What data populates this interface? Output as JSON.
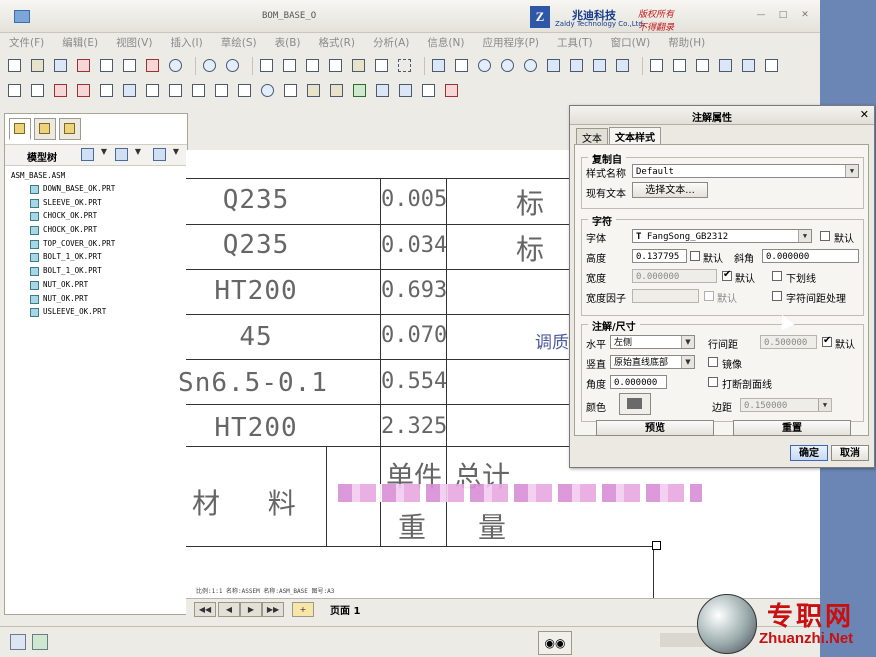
{
  "window": {
    "title": "BOM_BASE_O",
    "logo_mark": "Z",
    "logo_company_cn": "兆迪科技",
    "logo_company_en": "Zaldy Technology Co.,Ltd.",
    "logo_slogan_1": "版权所有",
    "logo_slogan_2": "不得翻录"
  },
  "menu": [
    "文件(F)",
    "编辑(E)",
    "视图(V)",
    "插入(I)",
    "草绘(S)",
    "表(B)",
    "格式(R)",
    "分析(A)",
    "信息(N)",
    "应用程序(P)",
    "工具(T)",
    "窗口(W)",
    "帮助(H)"
  ],
  "model_tree": {
    "title": "模型树",
    "root": "ASM_BASE.ASM",
    "items": [
      "DOWN_BASE_OK.PRT",
      "SLEEVE_OK.PRT",
      "CHOCK_OK.PRT",
      "CHOCK_OK.PRT",
      "TOP_COVER_OK.PRT",
      "BOLT_1_OK.PRT",
      "BOLT_1_OK.PRT",
      "NUT_OK.PRT",
      "NUT_OK.PRT",
      "USLEEVE_OK.PRT"
    ]
  },
  "drawing": {
    "materials": [
      "Q235",
      "Q235",
      "HT200",
      "45",
      "Sn6.5-0.1",
      "HT200"
    ],
    "weights": [
      "0.005",
      "0.034",
      "0.693",
      "0.070",
      "0.554",
      "2.325"
    ],
    "partial_char_1": "标",
    "partial_char_2": "标",
    "annotation_tiao": "调质",
    "header_material": "材  料",
    "header_unit_weight_1": "单件",
    "header_unit_weight_2": "重",
    "header_total_weight_1": "总计",
    "header_total_weight_2": "量",
    "footer_text": "比例:1:1   名称:ASSEM  名称:ASM_BASE  图号:A3"
  },
  "page_nav": {
    "page_label": "页面 1"
  },
  "dialog": {
    "title": "注解属性",
    "tabs": [
      "文本",
      "文本样式"
    ],
    "group_copy_from": "复制自",
    "style_name_label": "样式名称",
    "style_name_value": "Default",
    "existing_text_label": "现有文本",
    "select_text_button": "选择文本...",
    "group_char": "字符",
    "font_label": "字体",
    "font_value": "FangSong_GB2312",
    "font_default": "默认",
    "height_label": "高度",
    "height_value": "0.137795",
    "height_default": "默认",
    "slant_label": "斜角",
    "slant_value": "0.000000",
    "width_label": "宽度",
    "width_value": "0.000000",
    "width_default": "默认",
    "underline_label": "下划线",
    "width_factor_label": "宽度因子",
    "width_factor_default": "默认",
    "kerning_label": "字符间距处理",
    "group_note": "注解/尺寸",
    "horizontal_label": "水平",
    "horizontal_value": "左侧",
    "line_spacing_label": "行间距",
    "line_spacing_value": "0.500000",
    "line_spacing_default": "默认",
    "vertical_label": "竖直",
    "vertical_value": "原始直线底部",
    "mirror_label": "镜像",
    "angle_label": "角度",
    "angle_value": "0.000000",
    "break_hatch_label": "打断剖面线",
    "color_label": "颜色",
    "margin_label": "边距",
    "margin_value": "0.150000",
    "preview_button": "预览",
    "reset_button": "重置",
    "ok_button": "确定",
    "cancel_button": "取消"
  },
  "watermark": {
    "cn": "专职网",
    "en": "Zhuanzhi.Net"
  }
}
